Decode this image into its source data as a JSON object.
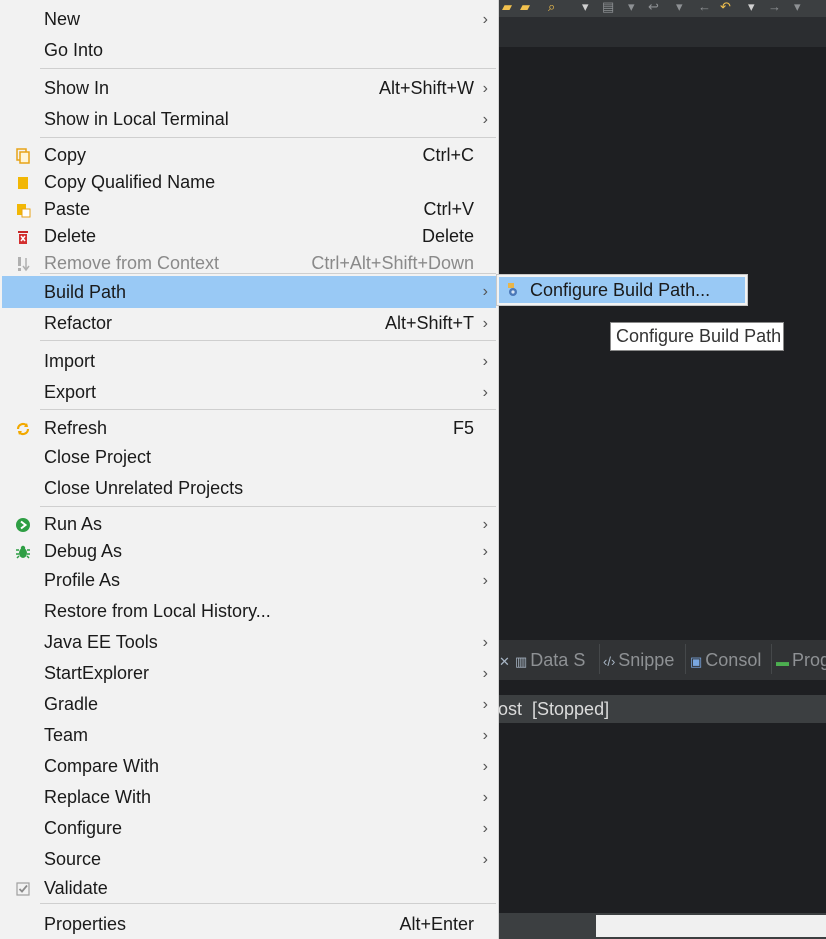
{
  "menu": {
    "items": [
      {
        "label": "New",
        "shortcut": "",
        "submenu": true,
        "icon": ""
      },
      {
        "label": "Go Into",
        "shortcut": "",
        "submenu": false,
        "icon": ""
      },
      {
        "label": "Show In",
        "shortcut": "Alt+Shift+W",
        "submenu": true,
        "icon": ""
      },
      {
        "label": "Show in Local Terminal",
        "shortcut": "",
        "submenu": true,
        "icon": ""
      },
      {
        "label": "Copy",
        "shortcut": "Ctrl+C",
        "submenu": false,
        "icon": "copy-icon"
      },
      {
        "label": "Copy Qualified Name",
        "shortcut": "",
        "submenu": false,
        "icon": "copy-qualified-name-icon"
      },
      {
        "label": "Paste",
        "shortcut": "Ctrl+V",
        "submenu": false,
        "icon": "paste-icon"
      },
      {
        "label": "Delete",
        "shortcut": "Delete",
        "submenu": false,
        "icon": "delete-icon"
      },
      {
        "label": "Remove from Context",
        "shortcut": "Ctrl+Alt+Shift+Down",
        "submenu": false,
        "icon": "remove-from-context-icon",
        "disabled": true
      },
      {
        "label": "Build Path",
        "shortcut": "",
        "submenu": true,
        "icon": "",
        "selected": true
      },
      {
        "label": "Refactor",
        "shortcut": "Alt+Shift+T",
        "submenu": true,
        "icon": ""
      },
      {
        "label": "Import",
        "shortcut": "",
        "submenu": true,
        "icon": ""
      },
      {
        "label": "Export",
        "shortcut": "",
        "submenu": true,
        "icon": ""
      },
      {
        "label": "Refresh",
        "shortcut": "F5",
        "submenu": false,
        "icon": "refresh-icon"
      },
      {
        "label": "Close Project",
        "shortcut": "",
        "submenu": false,
        "icon": ""
      },
      {
        "label": "Close Unrelated Projects",
        "shortcut": "",
        "submenu": false,
        "icon": ""
      },
      {
        "label": "Run As",
        "shortcut": "",
        "submenu": true,
        "icon": "run-icon"
      },
      {
        "label": "Debug As",
        "shortcut": "",
        "submenu": true,
        "icon": "debug-bug-icon"
      },
      {
        "label": "Profile As",
        "shortcut": "",
        "submenu": true,
        "icon": ""
      },
      {
        "label": "Restore from Local History...",
        "shortcut": "",
        "submenu": false,
        "icon": ""
      },
      {
        "label": "Java EE Tools",
        "shortcut": "",
        "submenu": true,
        "icon": ""
      },
      {
        "label": "StartExplorer",
        "shortcut": "",
        "submenu": true,
        "icon": ""
      },
      {
        "label": "Gradle",
        "shortcut": "",
        "submenu": true,
        "icon": ""
      },
      {
        "label": "Team",
        "shortcut": "",
        "submenu": true,
        "icon": ""
      },
      {
        "label": "Compare With",
        "shortcut": "",
        "submenu": true,
        "icon": ""
      },
      {
        "label": "Replace With",
        "shortcut": "",
        "submenu": true,
        "icon": ""
      },
      {
        "label": "Configure",
        "shortcut": "",
        "submenu": true,
        "icon": ""
      },
      {
        "label": "Source",
        "shortcut": "",
        "submenu": true,
        "icon": ""
      },
      {
        "label": "Validate",
        "shortcut": "",
        "submenu": false,
        "icon": "validate-check-icon"
      },
      {
        "label": "Properties",
        "shortcut": "Alt+Enter",
        "submenu": false,
        "icon": ""
      }
    ],
    "submenu_arrow": "›"
  },
  "submenu": {
    "items": [
      {
        "label": "Configure Build Path...",
        "icon": "build-path-icon",
        "selected": true
      }
    ]
  },
  "tooltip": {
    "text": "Configure Build Path"
  },
  "ide": {
    "view_tabs": [
      {
        "label": "Data S",
        "icon": "data-source-icon"
      },
      {
        "label": "Snippe",
        "icon": "snippets-icon"
      },
      {
        "label": "Consol",
        "icon": "console-icon"
      },
      {
        "label": "Prog",
        "icon": "progress-icon"
      }
    ],
    "console_status": "ost  [Stopped]",
    "colors": {
      "menu_bg": "#f2f2f2",
      "selection": "#99c9f5",
      "ide_dark": "#1e1f22",
      "panel": "#3c3f41"
    }
  }
}
